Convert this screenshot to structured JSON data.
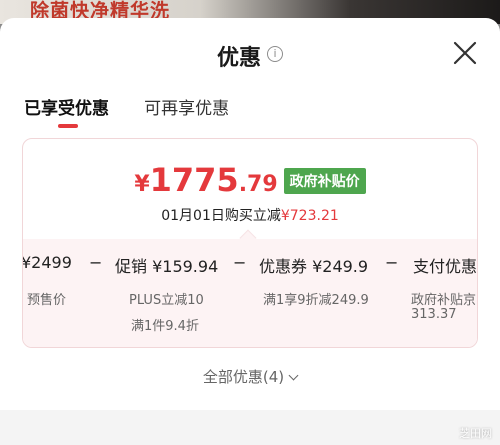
{
  "background": {
    "banner_text": "除菌快净精华洗"
  },
  "header": {
    "title": "优惠",
    "info_icon": "info-icon",
    "close_icon": "close-icon"
  },
  "tabs": [
    {
      "label": "已享受优惠",
      "active": true
    },
    {
      "label": "可再享优惠",
      "active": false
    }
  ],
  "card": {
    "price_symbol": "¥",
    "price_integer": "1775",
    "price_decimal": ".79",
    "badge": "政府补贴价",
    "purchase_prefix": "01月01日购买立减",
    "purchase_amount": "¥723.21",
    "breakdown": {
      "items": [
        {
          "value": "¥2499",
          "sub1": "预售价",
          "sub2": ""
        },
        {
          "op": "−",
          "value": "促销 ¥159.94",
          "sub1": "PLUS立减10",
          "sub2": "满1件9.4折"
        },
        {
          "op": "−",
          "value": "优惠券 ¥249.9",
          "sub1": "满1享9折减249.9",
          "sub2": ""
        },
        {
          "op": "−",
          "value": "支付优惠",
          "sub1": "政府补贴京",
          "sub2": "313.37"
        }
      ]
    }
  },
  "footer": {
    "all_offers": "全部优惠(4)"
  },
  "watermark": "芝田网",
  "colors": {
    "accent_red": "#e4393c",
    "gov_green": "#4ea64e",
    "pink_bg": "#fdf3f4"
  }
}
